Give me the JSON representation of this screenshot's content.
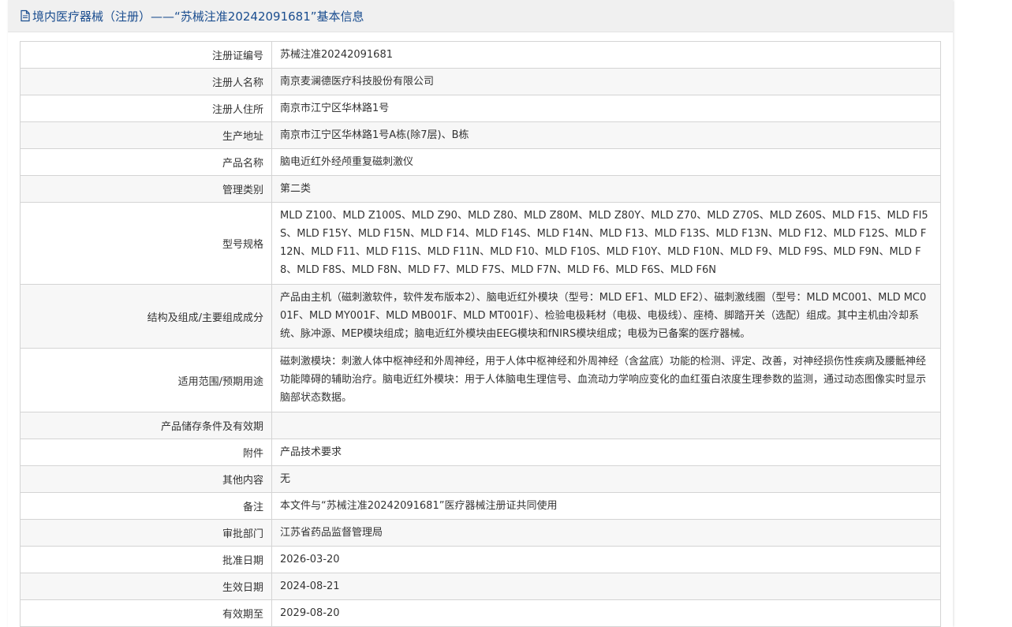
{
  "header": {
    "title": "境内医疗器械（注册）——“苏械注准20242091681”基本信息"
  },
  "rows": [
    {
      "label": "注册证编号",
      "value": "苏械注准20242091681"
    },
    {
      "label": "注册人名称",
      "value": "南京麦澜德医疗科技股份有限公司"
    },
    {
      "label": "注册人住所",
      "value": "南京市江宁区华林路1号"
    },
    {
      "label": "生产地址",
      "value": "南京市江宁区华林路1号A栋(除7层)、B栋"
    },
    {
      "label": "产品名称",
      "value": "脑电近红外经颅重复磁刺激仪"
    },
    {
      "label": "管理类别",
      "value": "第二类"
    },
    {
      "label": "型号规格",
      "value": "MLD Z100、MLD Z100S、MLD Z90、MLD Z80、MLD Z80M、MLD Z80Y、MLD Z70、MLD Z70S、MLD Z60S、MLD F15、MLD FI5S、MLD F15Y、MLD F15N、MLD F14、MLD F14S、MLD F14N、MLD F13、MLD F13S、MLD F13N、MLD F12、MLD F12S、MLD F12N、MLD F11、MLD F11S、MLD F11N、MLD F10、MLD F10S、MLD F10Y、MLD F10N、MLD F9、MLD F9S、MLD F9N、MLD F8、MLD F8S、MLD F8N、MLD F7、MLD F7S、MLD F7N、MLD F6、MLD F6S、MLD F6N"
    },
    {
      "label": "结构及组成/主要组成成分",
      "value": "产品由主机（磁刺激软件，软件发布版本2）、脑电近红外模块（型号：MLD EF1、MLD EF2）、磁刺激线圈（型号：MLD MC001、MLD MC001F、MLD MY001F、MLD MB001F、MLD MT001F）、检验电极耗材（电极、电极线）、座椅、脚踏开关（选配）组成。其中主机由冷却系统、脉冲源、MEP模块组成；脑电近红外模块由EEG模块和fNIRS模块组成；电极为已备案的医疗器械。"
    },
    {
      "label": "适用范围/预期用途",
      "value": "磁刺激模块：刺激人体中枢神经和外周神经，用于人体中枢神经和外周神经（含盆底）功能的检测、评定、改善，对神经损伤性疾病及腰骶神经功能障碍的辅助治疗。脑电近红外模块：用于人体脑电生理信号、血流动力学响应变化的血红蛋白浓度生理参数的监测，通过动态图像实时显示脑部状态数据。"
    },
    {
      "label": "产品储存条件及有效期",
      "value": ""
    },
    {
      "label": "附件",
      "value": "产品技术要求"
    },
    {
      "label": "其他内容",
      "value": "无"
    },
    {
      "label": "备注",
      "value": "本文件与“苏械注准20242091681”医疗器械注册证共同使用"
    },
    {
      "label": "审批部门",
      "value": "江苏省药品监督管理局"
    },
    {
      "label": "批准日期",
      "value": "2026-03-20"
    },
    {
      "label": "生效日期",
      "value": "2024-08-21"
    },
    {
      "label": "有效期至",
      "value": "2029-08-20"
    }
  ],
  "colors": {
    "header_bg": "#f0f0f0",
    "header_text": "#1a4d8f",
    "row_alt": "#f7f7f7",
    "border": "#d4d4d4"
  },
  "icons": {
    "header": "document-icon"
  }
}
